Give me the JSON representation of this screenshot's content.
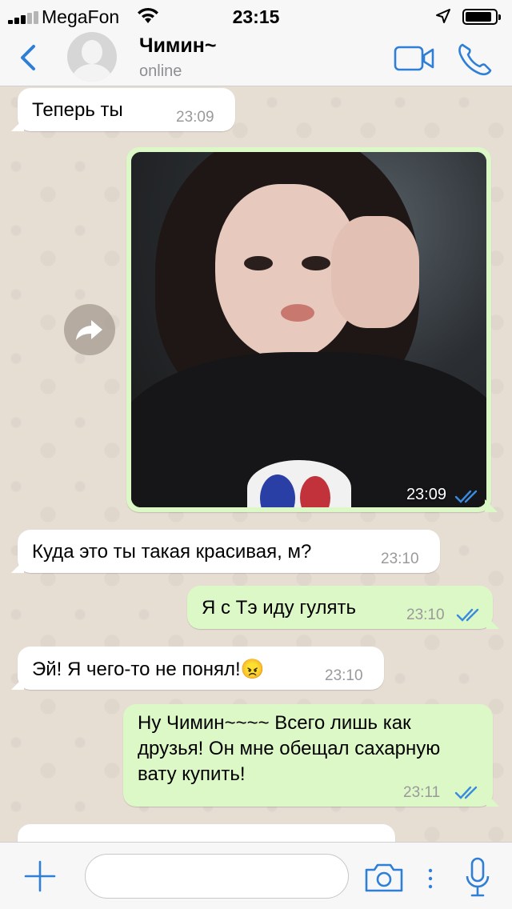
{
  "status_bar": {
    "carrier": "MegaFon",
    "time": "23:15"
  },
  "header": {
    "contact_name": "Чимин~",
    "status": "online"
  },
  "messages": [
    {
      "dir": "in",
      "text": "Теперь ты",
      "time": "23:09"
    },
    {
      "dir": "out",
      "type": "image",
      "time": "23:09",
      "read": true
    },
    {
      "dir": "in",
      "text": "Куда это ты такая красивая, м?",
      "time": "23:10"
    },
    {
      "dir": "out",
      "text": "Я с Тэ иду гулять",
      "time": "23:10",
      "read": true
    },
    {
      "dir": "in",
      "text": "Эй! Я чего-то не понял!",
      "emoji": "😠",
      "time": "23:10"
    },
    {
      "dir": "out",
      "text": "Ну Чимин~~~~ Всего лишь как друзья! Он мне обещал сахарную вату купить!",
      "time": "23:11",
      "read": true
    }
  ],
  "colors": {
    "accent": "#2f7fd6",
    "outgoing_bubble": "#dcf8c6",
    "incoming_bubble": "#ffffff",
    "read_ticks": "#3a8be0"
  },
  "icons": [
    "back-chevron-icon",
    "video-call-icon",
    "phone-call-icon",
    "forward-icon",
    "plus-icon",
    "camera-icon",
    "mic-icon"
  ]
}
